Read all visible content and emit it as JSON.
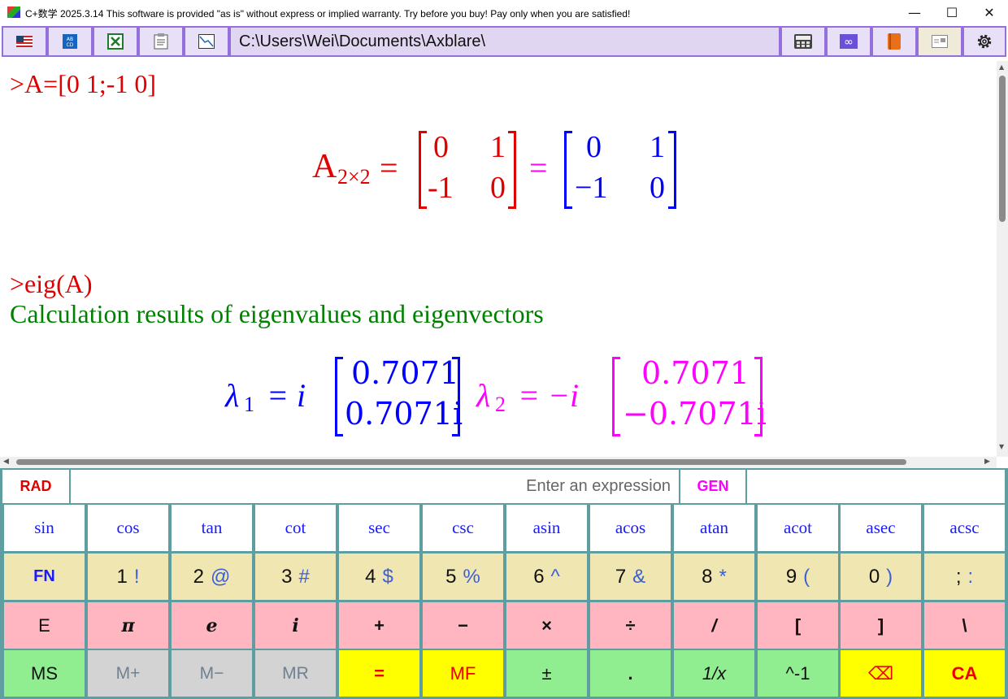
{
  "window": {
    "title": "C+数学 2025.3.14 This software is provided \"as is\" without express or implied warranty. Try before you buy! Pay only when you are satisfied!",
    "minimize": "—",
    "maximize": "☐",
    "close": "✕"
  },
  "toolbar": {
    "path": "C:\\Users\\Wei\\Documents\\Axblare\\",
    "left_icons": [
      "flag-us-icon",
      "abc-icon",
      "excel-icon",
      "clipboard-icon",
      "chart-icon"
    ],
    "right_icons": [
      "calculator-icon",
      "infinity-icon",
      "book-icon",
      "image-icon",
      "settings-icon"
    ]
  },
  "output": {
    "cmd1": ">A=[0 1;-1 0]",
    "matrix_name": "A",
    "matrix_sub": "2×2",
    "eq1": "=",
    "eq2": "=",
    "input_matrix": [
      [
        "0",
        "1"
      ],
      [
        "-1",
        "0"
      ]
    ],
    "rendered_matrix": [
      [
        "0",
        "1"
      ],
      [
        "−1",
        "0"
      ]
    ],
    "cmd2": ">eig(A)",
    "result_heading": "Calculation results of eigenvalues and eigenvectors",
    "lambda1": {
      "symbol": "λ",
      "sub": "1",
      "value": "= i",
      "vector": [
        "0.7071",
        "0.7071i"
      ]
    },
    "lambda2": {
      "symbol": "λ",
      "sub": "2",
      "value": "= −i",
      "vector": [
        "0.7071",
        "−0.7071i"
      ]
    },
    "colors": {
      "command": "#e00000",
      "heading": "#008000",
      "blue": "#0000ff",
      "magenta": "#ff00ff"
    }
  },
  "calc": {
    "angle_mode": "RAD",
    "expression_placeholder": "Enter an expression",
    "gen_button": "GEN",
    "result": "",
    "fn_row": [
      "sin",
      "cos",
      "tan",
      "cot",
      "sec",
      "csc",
      "asin",
      "acos",
      "atan",
      "acot",
      "asec",
      "acsc"
    ],
    "num_row": [
      {
        "main": "FN",
        "sub": ""
      },
      {
        "main": "1",
        "sub": "!"
      },
      {
        "main": "2",
        "sub": "@"
      },
      {
        "main": "3",
        "sub": "#"
      },
      {
        "main": "4",
        "sub": "$"
      },
      {
        "main": "5",
        "sub": "%"
      },
      {
        "main": "6",
        "sub": "^"
      },
      {
        "main": "7",
        "sub": "&"
      },
      {
        "main": "8",
        "sub": "*"
      },
      {
        "main": "9",
        "sub": "("
      },
      {
        "main": "0",
        "sub": ")"
      },
      {
        "main": ";",
        "sub": ":"
      }
    ],
    "op_row": [
      "E",
      "π",
      "e",
      "i",
      "+",
      "−",
      "×",
      "÷",
      "/",
      "[",
      "]",
      "\\"
    ],
    "mem_row": [
      "MS",
      "M+",
      "M−",
      "MR",
      "=",
      "MF",
      "±",
      ".",
      "1/x",
      "^-1",
      "⌫",
      "CA"
    ]
  }
}
